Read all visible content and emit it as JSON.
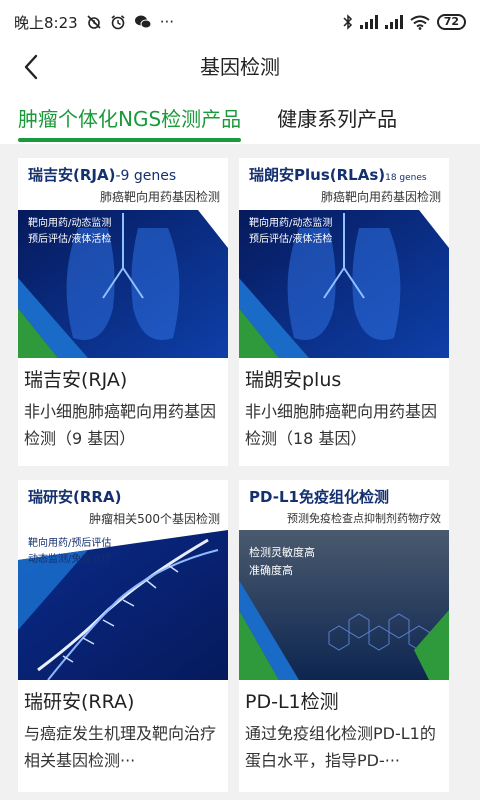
{
  "status_bar": {
    "time": "晚上8:23",
    "more": "···",
    "battery": "72",
    "icons": [
      "alarm-off-icon",
      "clock-icon",
      "wechat-icon",
      "bluetooth-icon",
      "signal-icon",
      "signal-icon",
      "wifi-icon",
      "battery-icon"
    ]
  },
  "header": {
    "title": "基因检测",
    "back_icon": "chevron-left-icon"
  },
  "tabs": [
    {
      "label": "肿瘤个体化NGS检测产品",
      "active": true
    },
    {
      "label": "健康系列产品",
      "active": false
    }
  ],
  "colors": {
    "accent": "#1a9a3a",
    "brand_navy": "#14306e",
    "image_blue": "#0b2a7a"
  },
  "products": [
    {
      "image": {
        "title": "瑞吉安(RJA)",
        "title_suffix": "-9 genes",
        "subtitle": "肺癌靶向用药基因检测",
        "tags": [
          "靶向用药/动态监测",
          "预后评估/液体活检"
        ]
      },
      "name": "瑞吉安(RJA)",
      "description": "非小细胞肺癌靶向用药基因检测（9 基因）"
    },
    {
      "image": {
        "title": "瑞朗安Plus(RLAs)",
        "title_suffix": "18 genes",
        "subtitle": "肺癌靶向用药基因检测",
        "tags": [
          "靶向用药/动态监测",
          "预后评估/液体活检"
        ]
      },
      "name": "瑞朗安plus",
      "description": "非小细胞肺癌靶向用药基因检测（18 基因）"
    },
    {
      "image": {
        "title": "瑞研安(RRA)",
        "title_suffix": "",
        "subtitle": "肿瘤相关500个基因检测",
        "tags": [
          "靶向用药/预后评估",
          "动态监测/免疫治疗"
        ]
      },
      "name": "瑞研安(RRA)",
      "description": "与癌症发生机理及靶向治疗相关基因检测···"
    },
    {
      "image": {
        "title": "PD-L1免疫组化检测",
        "title_suffix": "",
        "subtitle": "预测免疫检查点抑制剂药物疗效",
        "tags": [
          "检测灵敏度高",
          "准确度高"
        ]
      },
      "name": "PD-L1检测",
      "description": "通过免疫组化检测PD-L1的蛋白水平，指导PD-···"
    }
  ]
}
